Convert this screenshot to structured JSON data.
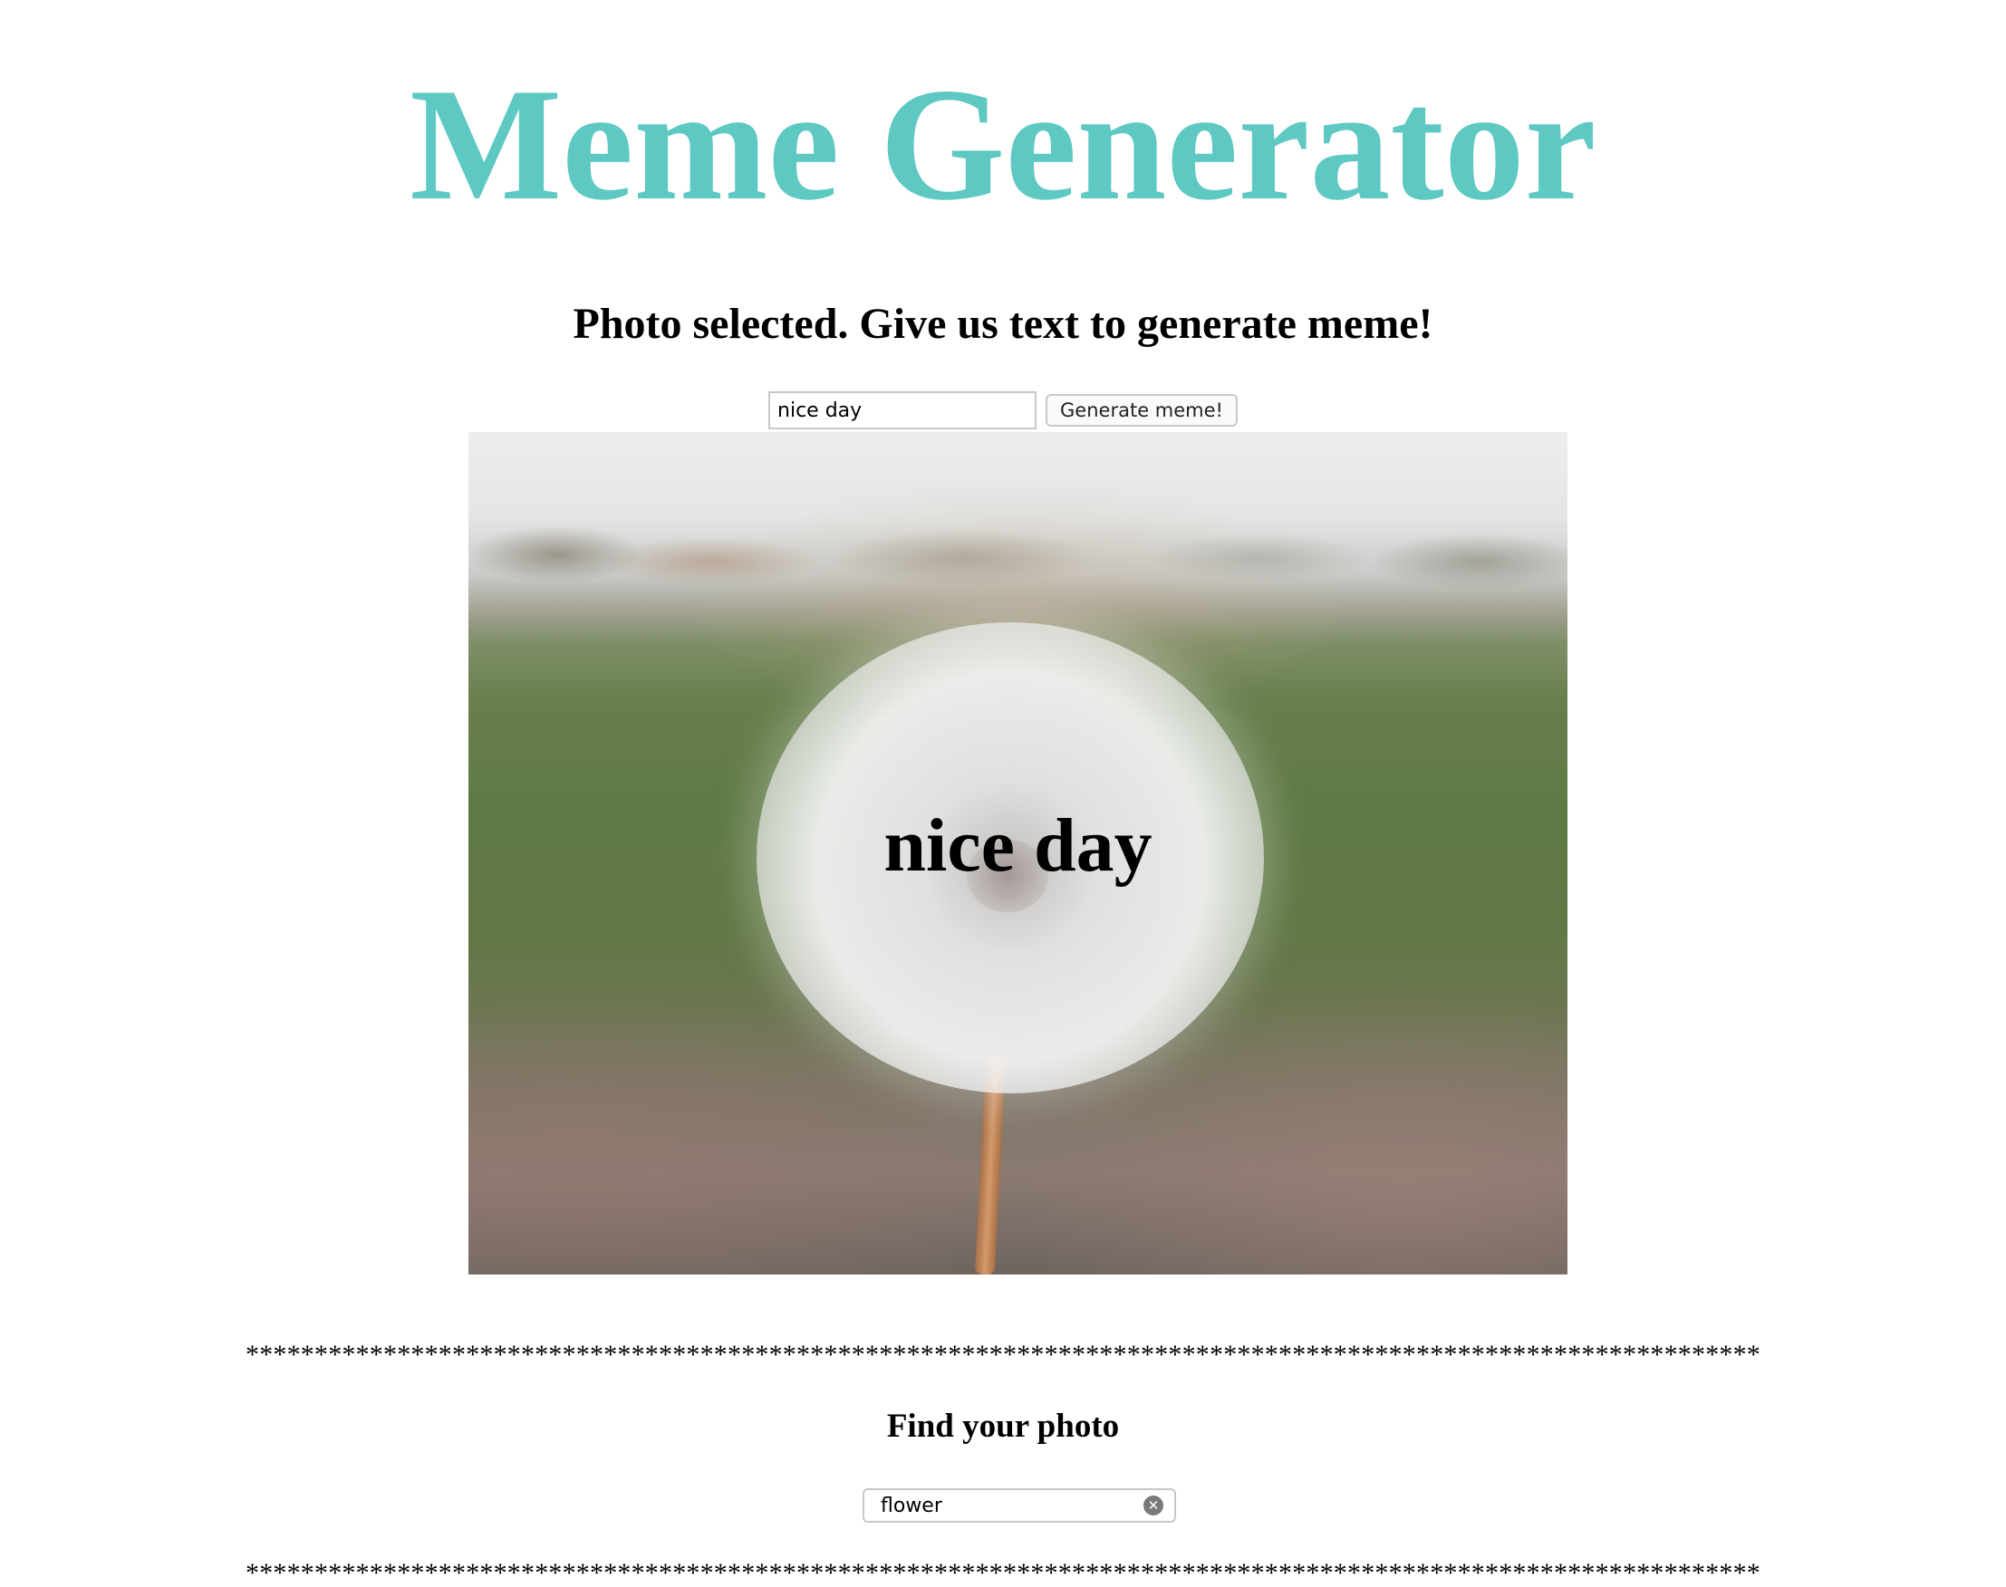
{
  "header": {
    "title": "Meme Generator",
    "title_color": "#5ec8c3"
  },
  "editor": {
    "status_message": "Photo selected. Give us text to generate meme!",
    "text_input_value": "nice day",
    "generate_button_label": "Generate meme!"
  },
  "meme": {
    "caption": "nice day",
    "photo_subject": "dandelion-seed-head-in-field"
  },
  "separator": {
    "text": "**************************************************************************************************************"
  },
  "search": {
    "heading": "Find your photo",
    "input_value": "flower",
    "clear_icon_glyph": "✕",
    "clear_icon_name": "clear-icon"
  }
}
